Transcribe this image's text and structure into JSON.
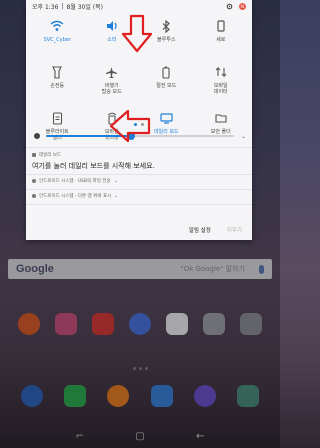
{
  "status_bar": {
    "time": "오후 1:36",
    "date": "8월 30일 (목)",
    "badge": "N"
  },
  "quick_settings": [
    {
      "label": "SVC_Cyber",
      "icon": "wifi-icon",
      "active": true
    },
    {
      "label": "소리",
      "icon": "sound-icon",
      "active": true
    },
    {
      "label": "블루투스",
      "icon": "bluetooth-icon",
      "active": false
    },
    {
      "label": "세로",
      "icon": "rotation-icon",
      "active": false
    },
    {
      "label": "손전등",
      "icon": "flashlight-icon",
      "active": false
    },
    {
      "label": "비행기\n탑승 모드",
      "icon": "airplane-icon",
      "active": false
    },
    {
      "label": "절전 모드",
      "icon": "battery-saver-icon",
      "active": false
    },
    {
      "label": "모바일\n데이터",
      "icon": "mobile-data-icon",
      "active": false
    },
    {
      "label": "블루라이트\n필터",
      "icon": "blue-light-filter-icon",
      "active": false
    },
    {
      "label": "모바일\n핫스팟",
      "icon": "mobile-hotspot-icon",
      "active": false
    },
    {
      "label": "데일리 보드",
      "icon": "daily-board-icon",
      "active": true
    },
    {
      "label": "보안 폴더",
      "icon": "secure-folder-icon",
      "active": false
    }
  ],
  "brightness": {
    "level_percent": 45
  },
  "notifications": {
    "daily_board": {
      "app": "데일리 보드",
      "title": "여기를 눌러 데일리 보드를 시작해 보세요."
    },
    "system_1": "안드로이드 시스템 · USB의 파일 전송",
    "system_2": "안드로이드 시스템 · 다른 앱 위에 표시"
  },
  "panel_buttons": {
    "block": "알림 설정",
    "clear": "지우기"
  },
  "home": {
    "search_hint": "\"Ok Google\" 말하기",
    "apps_row1": [
      "",
      "",
      "",
      "",
      "",
      "",
      ""
    ],
    "apps_row2": [
      "",
      "",
      "",
      "",
      "",
      ""
    ]
  },
  "colors": {
    "accent": "#1d7fd8",
    "annotation_arrow": "#e02020"
  }
}
